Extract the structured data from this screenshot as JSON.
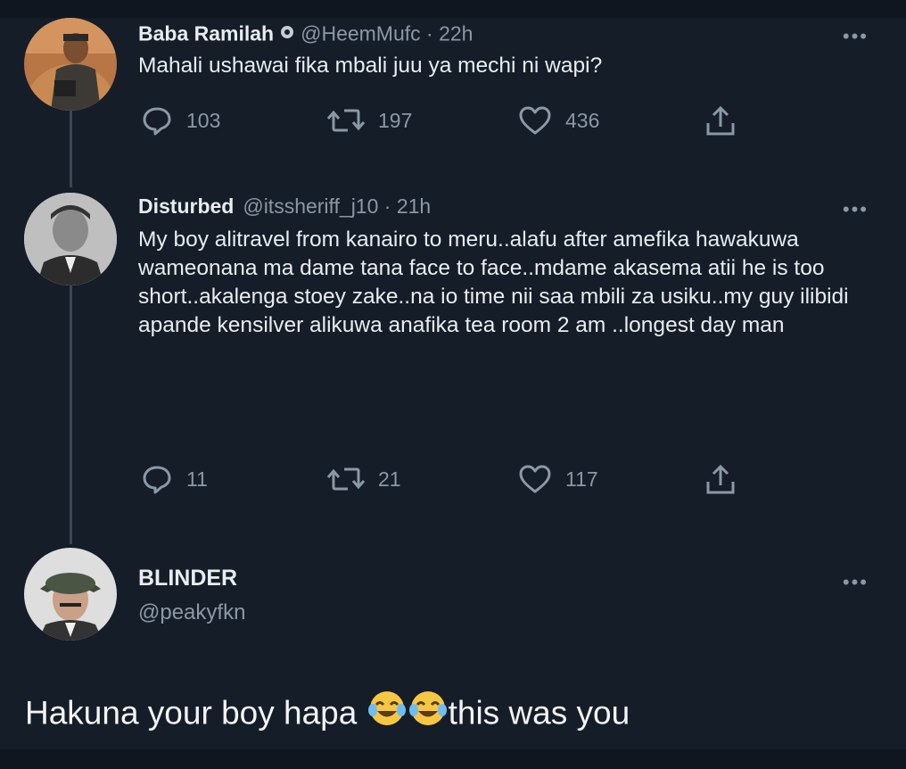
{
  "tweets": [
    {
      "name": "Baba Ramilah",
      "handle_time": "@HeemMufc · 22h",
      "text": "Mahali ushawai fika mbali juu ya mechi ni wapi?",
      "more": "•••",
      "replies": "103",
      "retweets": "197",
      "likes": "436"
    },
    {
      "name": "Disturbed",
      "handle_time": "@itssheriff_j10 · 21h",
      "text": "My boy alitravel from kanairo to meru..alafu after amefika hawakuwa wameonana ma dame tana face to face..mdame akasema atii he is too short..akalenga stoey zake..na io time nii saa mbili za usiku..my guy ilibidi apande kensilver alikuwa anafika tea room 2 am ..longest day man",
      "more": "•••",
      "replies": "11",
      "retweets": "21",
      "likes": "117"
    }
  ],
  "profile": {
    "name": "BLINDER",
    "handle": "@peakyfkn",
    "more": "•••"
  },
  "caption": {
    "before": "Hakuna your boy hapa ",
    "after": "this was you"
  },
  "icons": {
    "reply": "reply-icon",
    "retweet": "retweet-icon",
    "like": "heart-icon",
    "share": "share-icon",
    "verified": "verified-badge-icon",
    "emoji": "face-with-tears-of-joy-emoji"
  },
  "colors": {
    "background": "#151d29",
    "text": "#e9edf0",
    "muted": "#8b98a5",
    "thread_line": "#3a4654"
  }
}
